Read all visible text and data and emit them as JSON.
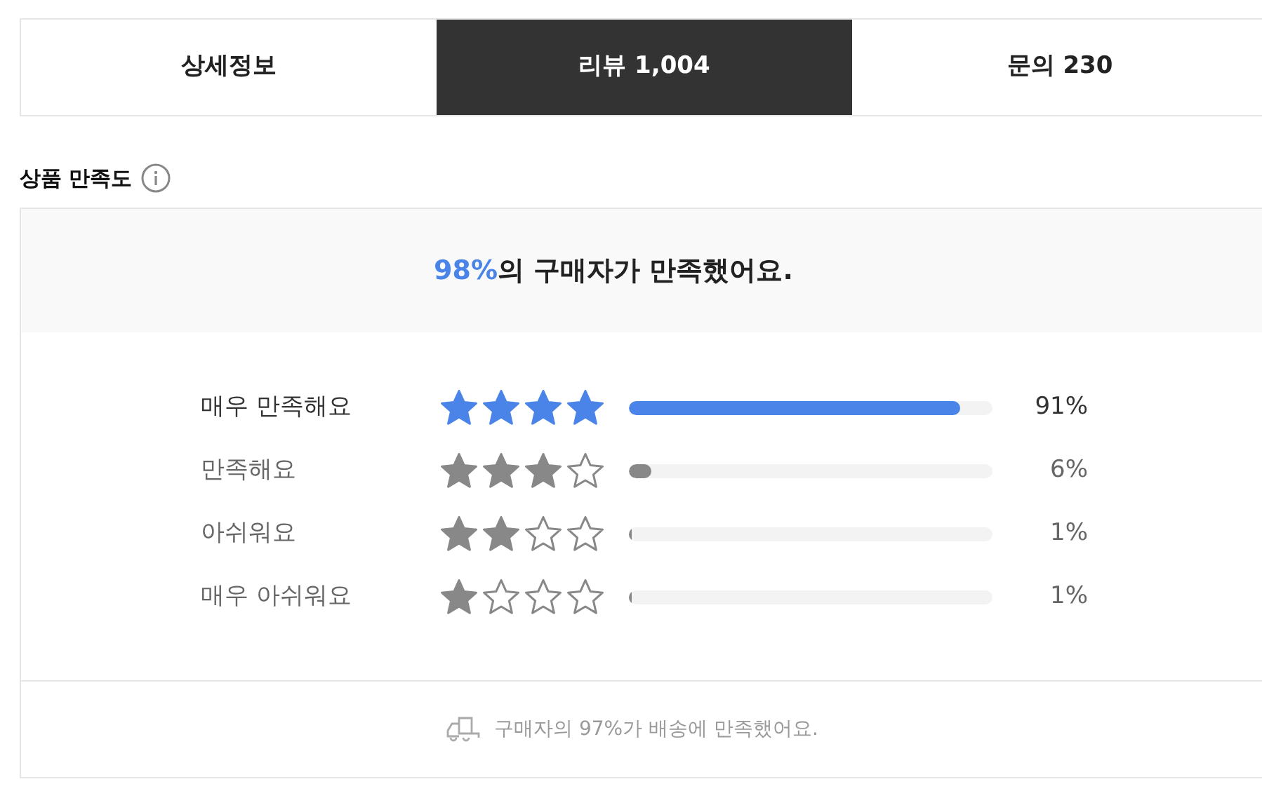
{
  "tabs": [
    {
      "label": "상세정보",
      "selected": false
    },
    {
      "label": "리뷰 1,004",
      "selected": true
    },
    {
      "label": "문의 230",
      "selected": false
    }
  ],
  "section_title": "상품 만족도",
  "summary": {
    "highlight": "98%",
    "text": "의 구매자가 만족했어요."
  },
  "ratings": [
    {
      "label": "매우 만족해요",
      "stars": 4,
      "highlighted": true,
      "level": 0.91,
      "percent": "91%"
    },
    {
      "label": "만족해요",
      "stars": 3,
      "highlighted": false,
      "level": 0.06,
      "percent": "6%"
    },
    {
      "label": "아쉬워요",
      "stars": 2,
      "highlighted": false,
      "level": 0.01,
      "percent": "1%"
    },
    {
      "label": "매우 아쉬워요",
      "stars": 1,
      "highlighted": false,
      "level": 0.01,
      "percent": "1%"
    }
  ],
  "delivery_note": "구매자의 97%가 배송에 만족했어요."
}
